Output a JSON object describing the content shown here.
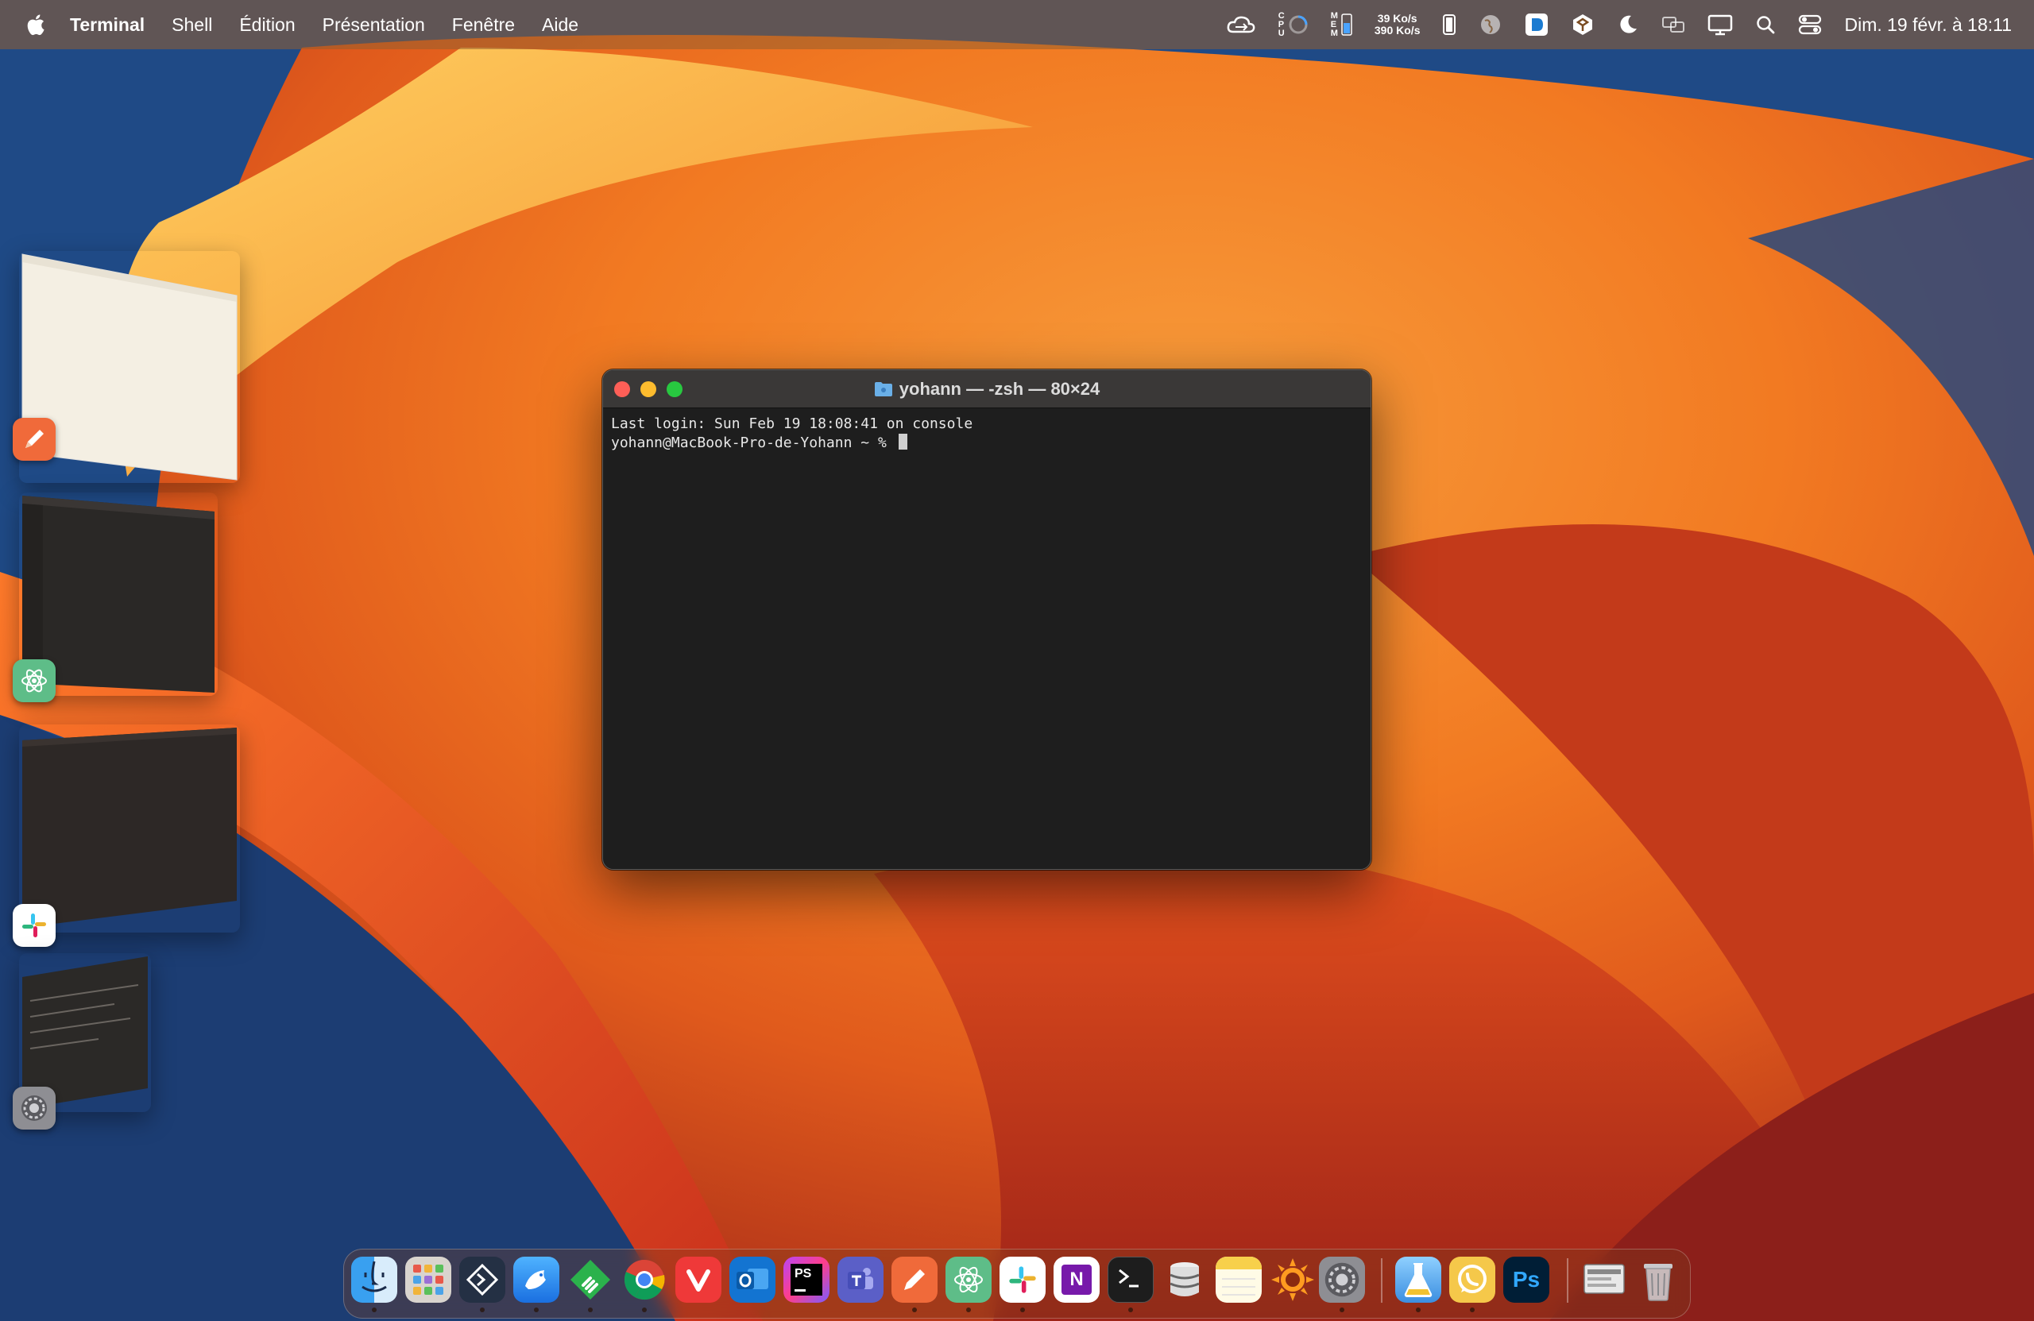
{
  "menubar": {
    "app_name": "Terminal",
    "items": [
      "Shell",
      "Édition",
      "Présentation",
      "Fenêtre",
      "Aide"
    ],
    "cpu_label": "C\nP\nU",
    "mem_label": "M\nE\nM",
    "net_down": "39 Ko/s",
    "net_up": "390 Ko/s",
    "clock": "Dim. 19 févr. à 18:11",
    "status_icons": [
      "cloud-sync-icon",
      "cpu-gauge-icon",
      "memory-gauge-icon",
      "net-speed",
      "battery-icon",
      "globe-icon",
      "dashlane-icon",
      "app-extension-icon",
      "moon-icon",
      "language-icon",
      "display-icon",
      "search-icon",
      "control-center-icon"
    ]
  },
  "terminal": {
    "title": "yohann — -zsh — 80×24",
    "lines": [
      "Last login: Sun Feb 19 18:08:41 on console",
      "yohann@MacBook-Pro-de-Yohann ~ % "
    ]
  },
  "stage_manager": {
    "groups": [
      {
        "app": "Pages / Text editor",
        "badge_icon": "pencil-icon"
      },
      {
        "app": "Atom",
        "badge_icon": "atom-icon"
      },
      {
        "app": "Slack",
        "badge_icon": "slack-icon"
      },
      {
        "app": "System Settings",
        "badge_icon": "settings-gear-icon"
      }
    ]
  },
  "dock": {
    "apps": [
      {
        "name": "Finder",
        "icon": "finder-icon",
        "running": true
      },
      {
        "name": "Launchpad",
        "icon": "launchpad-icon",
        "running": false
      },
      {
        "name": "Xcode-like",
        "icon": "diamond-app-icon",
        "running": true
      },
      {
        "name": "Proxyman",
        "icon": "bird-icon",
        "running": true
      },
      {
        "name": "Feedly",
        "icon": "feedly-icon",
        "running": true
      },
      {
        "name": "Chrome",
        "icon": "chrome-icon",
        "running": true
      },
      {
        "name": "Vivaldi",
        "icon": "vivaldi-icon",
        "running": false
      },
      {
        "name": "Outlook",
        "icon": "outlook-icon",
        "running": false
      },
      {
        "name": "PhpStorm",
        "icon": "phpstorm-icon",
        "running": false
      },
      {
        "name": "Teams",
        "icon": "teams-icon",
        "running": false
      },
      {
        "name": "Pencil",
        "icon": "pencil-icon",
        "running": true
      },
      {
        "name": "Atom",
        "icon": "atom-icon",
        "running": true
      },
      {
        "name": "Slack",
        "icon": "slack-icon",
        "running": true
      },
      {
        "name": "OneNote",
        "icon": "onenote-icon",
        "running": false
      },
      {
        "name": "Terminal",
        "icon": "terminal-icon",
        "running": true
      },
      {
        "name": "Sequel",
        "icon": "database-icon",
        "running": false
      },
      {
        "name": "Notes",
        "icon": "notes-icon",
        "running": false
      },
      {
        "name": "Sun app",
        "icon": "sun-icon",
        "running": false
      },
      {
        "name": "System Settings",
        "icon": "settings-gear-icon",
        "running": true
      },
      {
        "name": "Lab",
        "icon": "flask-icon",
        "running": true
      },
      {
        "name": "WhatsApp",
        "icon": "whatsapp-icon",
        "running": true
      },
      {
        "name": "Photoshop",
        "icon": "photoshop-icon",
        "running": false
      },
      {
        "name": "Downloads",
        "icon": "downloads-stack-icon",
        "running": false
      },
      {
        "name": "Trash",
        "icon": "trash-icon",
        "running": false
      }
    ],
    "labels": {
      "ps": "PS",
      "ps2": "Ps",
      "n": "N"
    }
  },
  "colors": {
    "menubar_bg": "#965f2d",
    "term_bg": "#1e1e1e",
    "term_title_bg": "#3a3837",
    "close": "#fe5f57",
    "minimize": "#febc2e",
    "maximize": "#28c840"
  }
}
